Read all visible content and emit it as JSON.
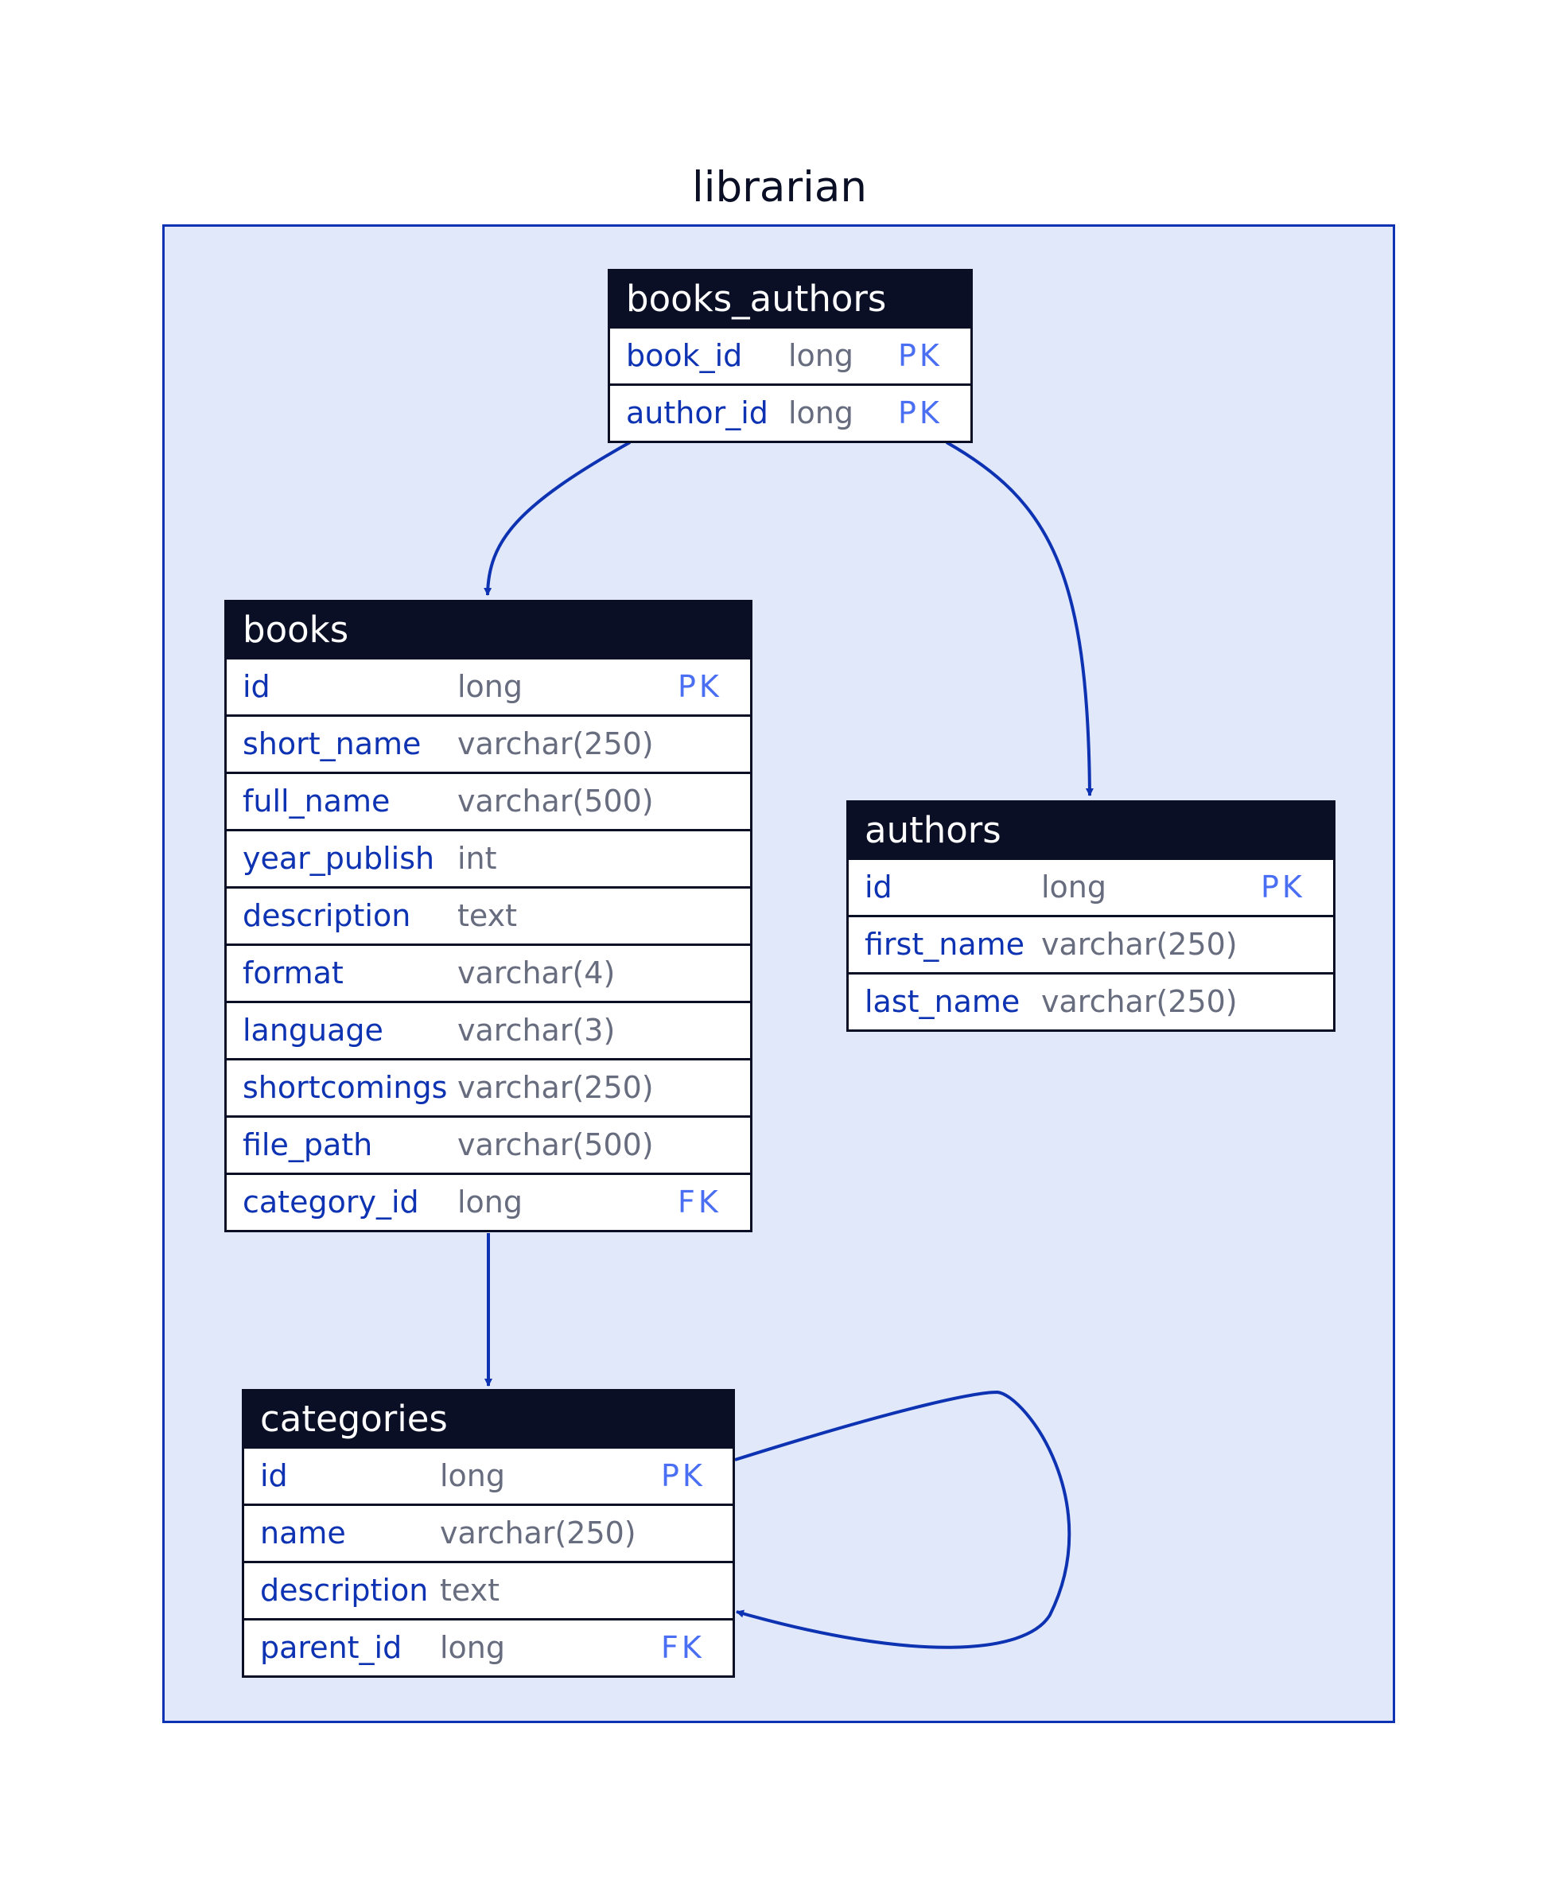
{
  "diagram": {
    "title": "librarian",
    "colors": {
      "container_fill": "#e1e8fa",
      "container_border": "#0d32b2",
      "header_fill": "#0a0f25",
      "header_text": "#ffffff",
      "column_name": "#0d32b2",
      "column_type": "#676c7e",
      "column_key": "#4a6ff3",
      "edge": "#0d32b2"
    },
    "tables": {
      "books_authors": {
        "name": "books_authors",
        "columns": [
          {
            "name": "book_id",
            "type": "long",
            "key": "PK"
          },
          {
            "name": "author_id",
            "type": "long",
            "key": "PK"
          }
        ]
      },
      "books": {
        "name": "books",
        "columns": [
          {
            "name": "id",
            "type": "long",
            "key": "PK"
          },
          {
            "name": "short_name",
            "type": "varchar(250)",
            "key": ""
          },
          {
            "name": "full_name",
            "type": "varchar(500)",
            "key": ""
          },
          {
            "name": "year_publish",
            "type": "int",
            "key": ""
          },
          {
            "name": "description",
            "type": "text",
            "key": ""
          },
          {
            "name": "format",
            "type": "varchar(4)",
            "key": ""
          },
          {
            "name": "language",
            "type": "varchar(3)",
            "key": ""
          },
          {
            "name": "shortcomings",
            "type": "varchar(250)",
            "key": ""
          },
          {
            "name": "file_path",
            "type": "varchar(500)",
            "key": ""
          },
          {
            "name": "category_id",
            "type": "long",
            "key": "FK"
          }
        ]
      },
      "authors": {
        "name": "authors",
        "columns": [
          {
            "name": "id",
            "type": "long",
            "key": "PK"
          },
          {
            "name": "first_name",
            "type": "varchar(250)",
            "key": ""
          },
          {
            "name": "last_name",
            "type": "varchar(250)",
            "key": ""
          }
        ]
      },
      "categories": {
        "name": "categories",
        "columns": [
          {
            "name": "id",
            "type": "long",
            "key": "PK"
          },
          {
            "name": "name",
            "type": "varchar(250)",
            "key": ""
          },
          {
            "name": "description",
            "type": "text",
            "key": ""
          },
          {
            "name": "parent_id",
            "type": "long",
            "key": "FK"
          }
        ]
      }
    },
    "relationships": [
      {
        "from": "books_authors",
        "to": "books"
      },
      {
        "from": "books_authors",
        "to": "authors"
      },
      {
        "from": "books",
        "to": "categories"
      },
      {
        "from": "categories",
        "to": "categories"
      }
    ]
  }
}
